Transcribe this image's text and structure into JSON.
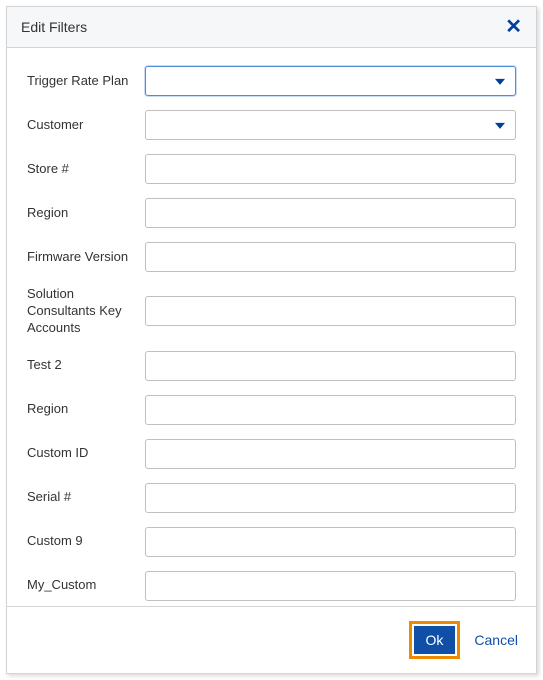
{
  "dialog": {
    "title": "Edit Filters",
    "close_icon": "✕"
  },
  "fields": {
    "trigger_rate_plan": {
      "label": "Trigger Rate Plan",
      "value": ""
    },
    "customer": {
      "label": "Customer",
      "value": ""
    },
    "store_num": {
      "label": "Store #",
      "value": ""
    },
    "region": {
      "label": "Region",
      "value": ""
    },
    "firmware_version": {
      "label": "Firmware Version",
      "value": ""
    },
    "solution_consultants": {
      "label": "Solution Consultants Key Accounts",
      "value": ""
    },
    "test_2": {
      "label": "Test 2",
      "value": ""
    },
    "region2": {
      "label": "Region",
      "value": ""
    },
    "custom_id": {
      "label": "Custom ID",
      "value": ""
    },
    "serial_num": {
      "label": "Serial #",
      "value": ""
    },
    "custom_9": {
      "label": "Custom 9",
      "value": ""
    },
    "my_custom": {
      "label": "My_Custom",
      "value": ""
    }
  },
  "footer": {
    "ok_label": "Ok",
    "cancel_label": "Cancel"
  }
}
